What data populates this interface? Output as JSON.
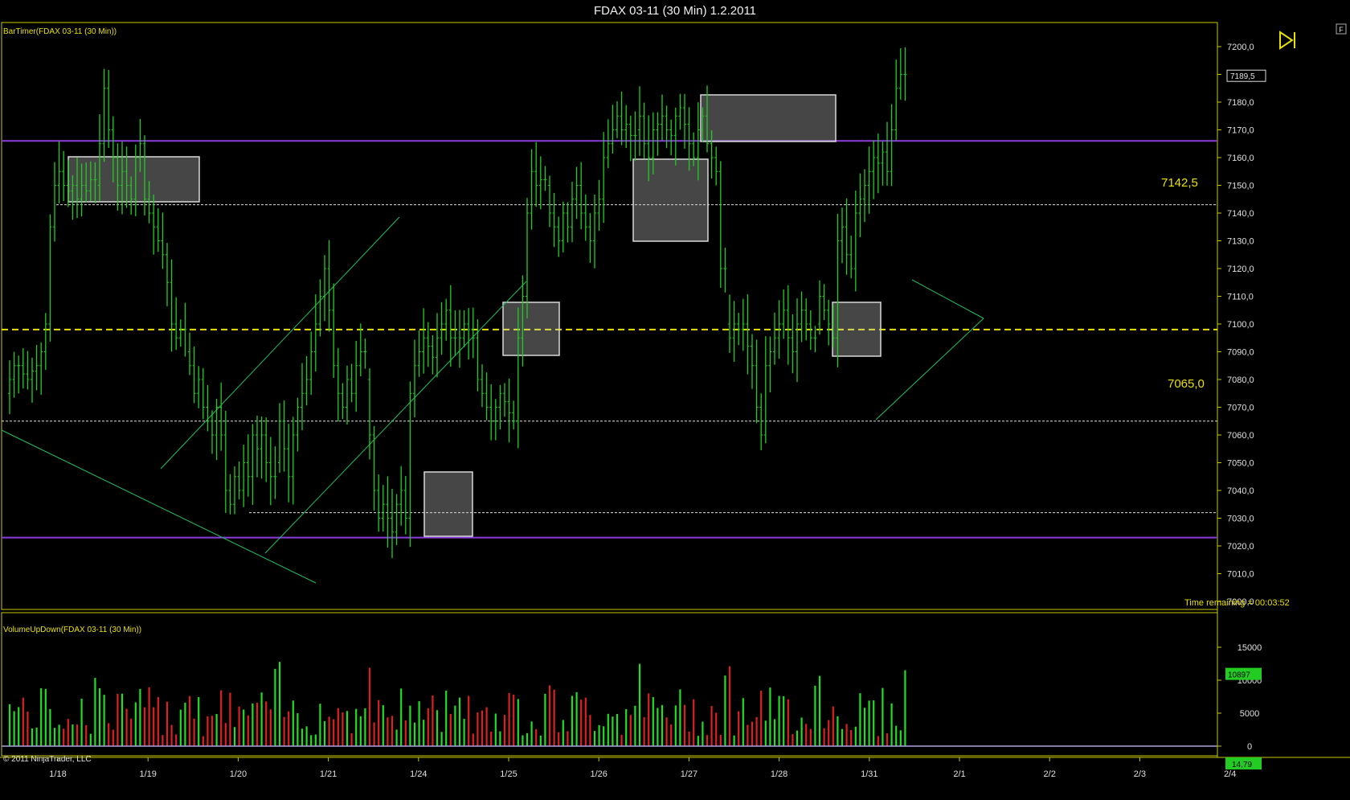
{
  "window": {
    "title": "FDAX 03-11 (30 Min)  1.2.2011",
    "corner_button": "F"
  },
  "price_panel": {
    "indicator_label": "BarTimer(FDAX 03-11 (30 Min))",
    "time_remaining": "Time remaining = 00:03:52",
    "current_price": "7189,5",
    "ylim": [
      6995,
      7215
    ],
    "ticks": [
      "7200,0",
      "7190,0",
      "7180,0",
      "7170,0",
      "7160,0",
      "7150,0",
      "7140,0",
      "7130,0",
      "7120,0",
      "7110,0",
      "7100,0",
      "7090,0",
      "7080,0",
      "7070,0",
      "7060,0",
      "7050,0",
      "7040,0",
      "7030,0",
      "7020,0",
      "7010,0",
      "7000,0"
    ],
    "tick_values": [
      7200,
      7190,
      7180,
      7170,
      7160,
      7150,
      7140,
      7130,
      7120,
      7110,
      7100,
      7090,
      7080,
      7070,
      7060,
      7050,
      7040,
      7030,
      7020,
      7010,
      7000
    ],
    "annotation_upper": "7142,5",
    "annotation_lower": "7065,0"
  },
  "volume_panel": {
    "indicator_label": "VolumeUpDown(FDAX 03-11 (30 Min))",
    "current_volume": "10897",
    "ticks": [
      "15000",
      "10000",
      "5000",
      "0"
    ],
    "tick_values": [
      15000,
      10000,
      5000,
      0
    ],
    "ylim": [
      0,
      18000
    ]
  },
  "footer": {
    "copyright": "© 2011 NinjaTrader, LLC",
    "extra_value": "14,79"
  },
  "x_axis": {
    "labels": [
      "1/18",
      "1/19",
      "1/20",
      "1/21",
      "1/24",
      "1/25",
      "1/26",
      "1/27",
      "1/28",
      "1/31",
      "2/1",
      "2/2",
      "2/3",
      "2/4"
    ]
  },
  "colors": {
    "background": "#000000",
    "frame": "#c8c800",
    "bar": "#22cc22",
    "volume_up": "#22dd22",
    "volume_down": "#dd2020",
    "support_resistance": "#8c3cdc",
    "dashed_pivot": "#e8e000",
    "trendline": "#20c060",
    "highlight_box": "#d8d8d8"
  },
  "chart_data": {
    "type": "bar",
    "title": "FDAX 03-11 (30 Min)  1.2.2011",
    "price_series": [
      {
        "date": "1/18",
        "values": [
          7075,
          7080,
          7085,
          7085,
          7082,
          7080,
          7083,
          7085,
          7090,
          7100,
          7135,
          7150,
          7155,
          7150,
          7148,
          7150,
          7145,
          7150,
          7148,
          7152
        ]
      },
      {
        "date": "1/19",
        "values": [
          7150,
          7165,
          7185,
          7170,
          7160,
          7150,
          7155,
          7150,
          7145,
          7160,
          7165,
          7145,
          7140,
          7135,
          7130,
          7125,
          7115,
          7100,
          7095,
          7098
        ]
      },
      {
        "date": "1/20",
        "values": [
          7090,
          7085,
          7075,
          7080,
          7070,
          7065,
          7060,
          7070,
          7060,
          7040,
          7035,
          7045,
          7040,
          7050,
          7045,
          7060,
          7055,
          7060,
          7050,
          7045
        ]
      },
      {
        "date": "1/21",
        "values": [
          7050,
          7065,
          7055,
          7045,
          7060,
          7070,
          7075,
          7080,
          7090,
          7100,
          7110,
          7120,
          7105,
          7085,
          7075,
          7070,
          7080,
          7075,
          7085,
          7090
        ]
      },
      {
        "date": "1/24",
        "values": [
          7080,
          7060,
          7040,
          7030,
          7035,
          7030,
          7025,
          7035,
          7040,
          7030,
          7075,
          7085,
          7090,
          7095,
          7092,
          7088,
          7095,
          7100,
          7105,
          7095
        ]
      },
      {
        "date": "1/25",
        "values": [
          7090,
          7095,
          7100,
          7098,
          7095,
          7080,
          7075,
          7070,
          7065,
          7070,
          7075,
          7072,
          7068,
          7065,
          7095,
          7110,
          7140,
          7155,
          7150,
          7152
        ]
      },
      {
        "date": "1/26",
        "values": [
          7150,
          7140,
          7135,
          7130,
          7140,
          7135,
          7145,
          7150,
          7140,
          7135,
          7130,
          7140,
          7145,
          7160,
          7165,
          7170,
          7175,
          7170,
          7172,
          7168
        ]
      },
      {
        "date": "1/27",
        "values": [
          7170,
          7175,
          7165,
          7160,
          7170,
          7172,
          7175,
          7170,
          7168,
          7175,
          7178,
          7172,
          7165,
          7160,
          7170,
          7175,
          7165,
          7160,
          7155,
          7120
        ]
      },
      {
        "date": "1/28",
        "values": [
          7100,
          7095,
          7100,
          7098,
          7100,
          7092,
          7085,
          7070,
          7060,
          7085,
          7090,
          7095,
          7100,
          7105,
          7095,
          7090,
          7100,
          7105,
          7100,
          7095
        ]
      },
      {
        "date": "1/31",
        "values": [
          7100,
          7110,
          7105,
          7100,
          7095,
          7130,
          7135,
          7125,
          7120,
          7140,
          7145,
          7150,
          7155,
          7160,
          7158,
          7162,
          7155,
          7170,
          7185,
          7190
        ]
      }
    ],
    "levels": {
      "resistance": 7166,
      "support": 7023,
      "pivot": 7098,
      "upper_dotted": 7143,
      "lower_dotted": 7065,
      "low_dotted": 7032
    },
    "volume_series": {
      "name": "Volume",
      "note_up_down": "green up / red down"
    },
    "xlabel": "",
    "ylabel": "",
    "grid": false
  }
}
